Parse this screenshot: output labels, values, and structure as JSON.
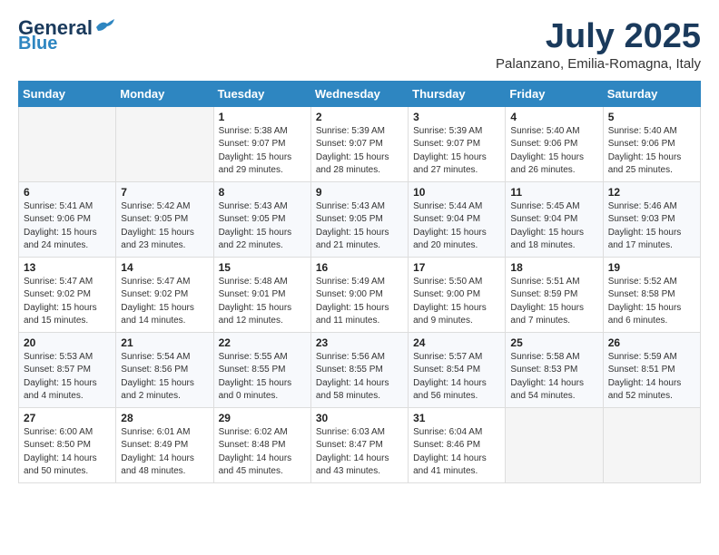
{
  "logo": {
    "general": "General",
    "blue": "Blue"
  },
  "header": {
    "month": "July 2025",
    "location": "Palanzano, Emilia-Romagna, Italy"
  },
  "weekdays": [
    "Sunday",
    "Monday",
    "Tuesday",
    "Wednesday",
    "Thursday",
    "Friday",
    "Saturday"
  ],
  "weeks": [
    [
      {
        "day": "",
        "info": ""
      },
      {
        "day": "",
        "info": ""
      },
      {
        "day": "1",
        "info": "Sunrise: 5:38 AM\nSunset: 9:07 PM\nDaylight: 15 hours and 29 minutes."
      },
      {
        "day": "2",
        "info": "Sunrise: 5:39 AM\nSunset: 9:07 PM\nDaylight: 15 hours and 28 minutes."
      },
      {
        "day": "3",
        "info": "Sunrise: 5:39 AM\nSunset: 9:07 PM\nDaylight: 15 hours and 27 minutes."
      },
      {
        "day": "4",
        "info": "Sunrise: 5:40 AM\nSunset: 9:06 PM\nDaylight: 15 hours and 26 minutes."
      },
      {
        "day": "5",
        "info": "Sunrise: 5:40 AM\nSunset: 9:06 PM\nDaylight: 15 hours and 25 minutes."
      }
    ],
    [
      {
        "day": "6",
        "info": "Sunrise: 5:41 AM\nSunset: 9:06 PM\nDaylight: 15 hours and 24 minutes."
      },
      {
        "day": "7",
        "info": "Sunrise: 5:42 AM\nSunset: 9:05 PM\nDaylight: 15 hours and 23 minutes."
      },
      {
        "day": "8",
        "info": "Sunrise: 5:43 AM\nSunset: 9:05 PM\nDaylight: 15 hours and 22 minutes."
      },
      {
        "day": "9",
        "info": "Sunrise: 5:43 AM\nSunset: 9:05 PM\nDaylight: 15 hours and 21 minutes."
      },
      {
        "day": "10",
        "info": "Sunrise: 5:44 AM\nSunset: 9:04 PM\nDaylight: 15 hours and 20 minutes."
      },
      {
        "day": "11",
        "info": "Sunrise: 5:45 AM\nSunset: 9:04 PM\nDaylight: 15 hours and 18 minutes."
      },
      {
        "day": "12",
        "info": "Sunrise: 5:46 AM\nSunset: 9:03 PM\nDaylight: 15 hours and 17 minutes."
      }
    ],
    [
      {
        "day": "13",
        "info": "Sunrise: 5:47 AM\nSunset: 9:02 PM\nDaylight: 15 hours and 15 minutes."
      },
      {
        "day": "14",
        "info": "Sunrise: 5:47 AM\nSunset: 9:02 PM\nDaylight: 15 hours and 14 minutes."
      },
      {
        "day": "15",
        "info": "Sunrise: 5:48 AM\nSunset: 9:01 PM\nDaylight: 15 hours and 12 minutes."
      },
      {
        "day": "16",
        "info": "Sunrise: 5:49 AM\nSunset: 9:00 PM\nDaylight: 15 hours and 11 minutes."
      },
      {
        "day": "17",
        "info": "Sunrise: 5:50 AM\nSunset: 9:00 PM\nDaylight: 15 hours and 9 minutes."
      },
      {
        "day": "18",
        "info": "Sunrise: 5:51 AM\nSunset: 8:59 PM\nDaylight: 15 hours and 7 minutes."
      },
      {
        "day": "19",
        "info": "Sunrise: 5:52 AM\nSunset: 8:58 PM\nDaylight: 15 hours and 6 minutes."
      }
    ],
    [
      {
        "day": "20",
        "info": "Sunrise: 5:53 AM\nSunset: 8:57 PM\nDaylight: 15 hours and 4 minutes."
      },
      {
        "day": "21",
        "info": "Sunrise: 5:54 AM\nSunset: 8:56 PM\nDaylight: 15 hours and 2 minutes."
      },
      {
        "day": "22",
        "info": "Sunrise: 5:55 AM\nSunset: 8:55 PM\nDaylight: 15 hours and 0 minutes."
      },
      {
        "day": "23",
        "info": "Sunrise: 5:56 AM\nSunset: 8:55 PM\nDaylight: 14 hours and 58 minutes."
      },
      {
        "day": "24",
        "info": "Sunrise: 5:57 AM\nSunset: 8:54 PM\nDaylight: 14 hours and 56 minutes."
      },
      {
        "day": "25",
        "info": "Sunrise: 5:58 AM\nSunset: 8:53 PM\nDaylight: 14 hours and 54 minutes."
      },
      {
        "day": "26",
        "info": "Sunrise: 5:59 AM\nSunset: 8:51 PM\nDaylight: 14 hours and 52 minutes."
      }
    ],
    [
      {
        "day": "27",
        "info": "Sunrise: 6:00 AM\nSunset: 8:50 PM\nDaylight: 14 hours and 50 minutes."
      },
      {
        "day": "28",
        "info": "Sunrise: 6:01 AM\nSunset: 8:49 PM\nDaylight: 14 hours and 48 minutes."
      },
      {
        "day": "29",
        "info": "Sunrise: 6:02 AM\nSunset: 8:48 PM\nDaylight: 14 hours and 45 minutes."
      },
      {
        "day": "30",
        "info": "Sunrise: 6:03 AM\nSunset: 8:47 PM\nDaylight: 14 hours and 43 minutes."
      },
      {
        "day": "31",
        "info": "Sunrise: 6:04 AM\nSunset: 8:46 PM\nDaylight: 14 hours and 41 minutes."
      },
      {
        "day": "",
        "info": ""
      },
      {
        "day": "",
        "info": ""
      }
    ]
  ]
}
